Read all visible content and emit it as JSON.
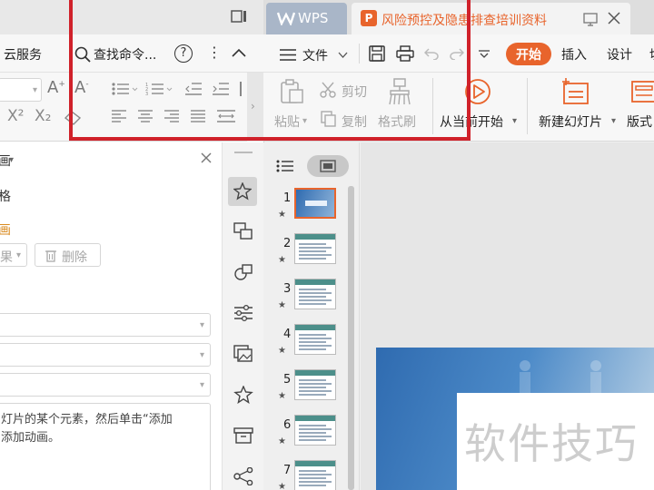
{
  "left_window": {
    "toolbar": {
      "cloud_service": "云服务",
      "search_placeholder": "查找命令...",
      "help": "?",
      "more": "⋮",
      "collapse": "∧"
    },
    "ribbon": {
      "superscript": "X²",
      "subscript": "X₂"
    },
    "pane": {
      "title_partial": "画",
      "item_partial": "格",
      "link_partial": "画",
      "effect_partial": "果",
      "delete_label": "删除",
      "hint_line1": "灯片的某个元素，然后单击“添加",
      "hint_line2": "添加动画。"
    }
  },
  "right_window": {
    "tabs": {
      "wps_label": "WPS",
      "doc_title": "风险预控及隐患排查培训资料"
    },
    "toolbar": {
      "file_label": "文件",
      "menu_start": "开始",
      "menu_insert": "插入",
      "menu_design": "设计",
      "menu_switch_partial": "切"
    },
    "ribbon": {
      "paste": "粘贴",
      "cut": "剪切",
      "copy": "复制",
      "format_painter": "格式刷",
      "from_current": "从当前开始",
      "new_slide": "新建幻灯片",
      "layout": "版式"
    },
    "thumbnails": [
      {
        "num": "1"
      },
      {
        "num": "2"
      },
      {
        "num": "3"
      },
      {
        "num": "4"
      },
      {
        "num": "5"
      },
      {
        "num": "6"
      },
      {
        "num": "7"
      }
    ],
    "canvas": {
      "watermark": "软件技巧"
    }
  },
  "colors": {
    "accent_orange": "#e8642c",
    "annotation_red": "#d0212a",
    "wps_tab": "#a9b6c8",
    "slide_blue": "#2f6bb0"
  }
}
